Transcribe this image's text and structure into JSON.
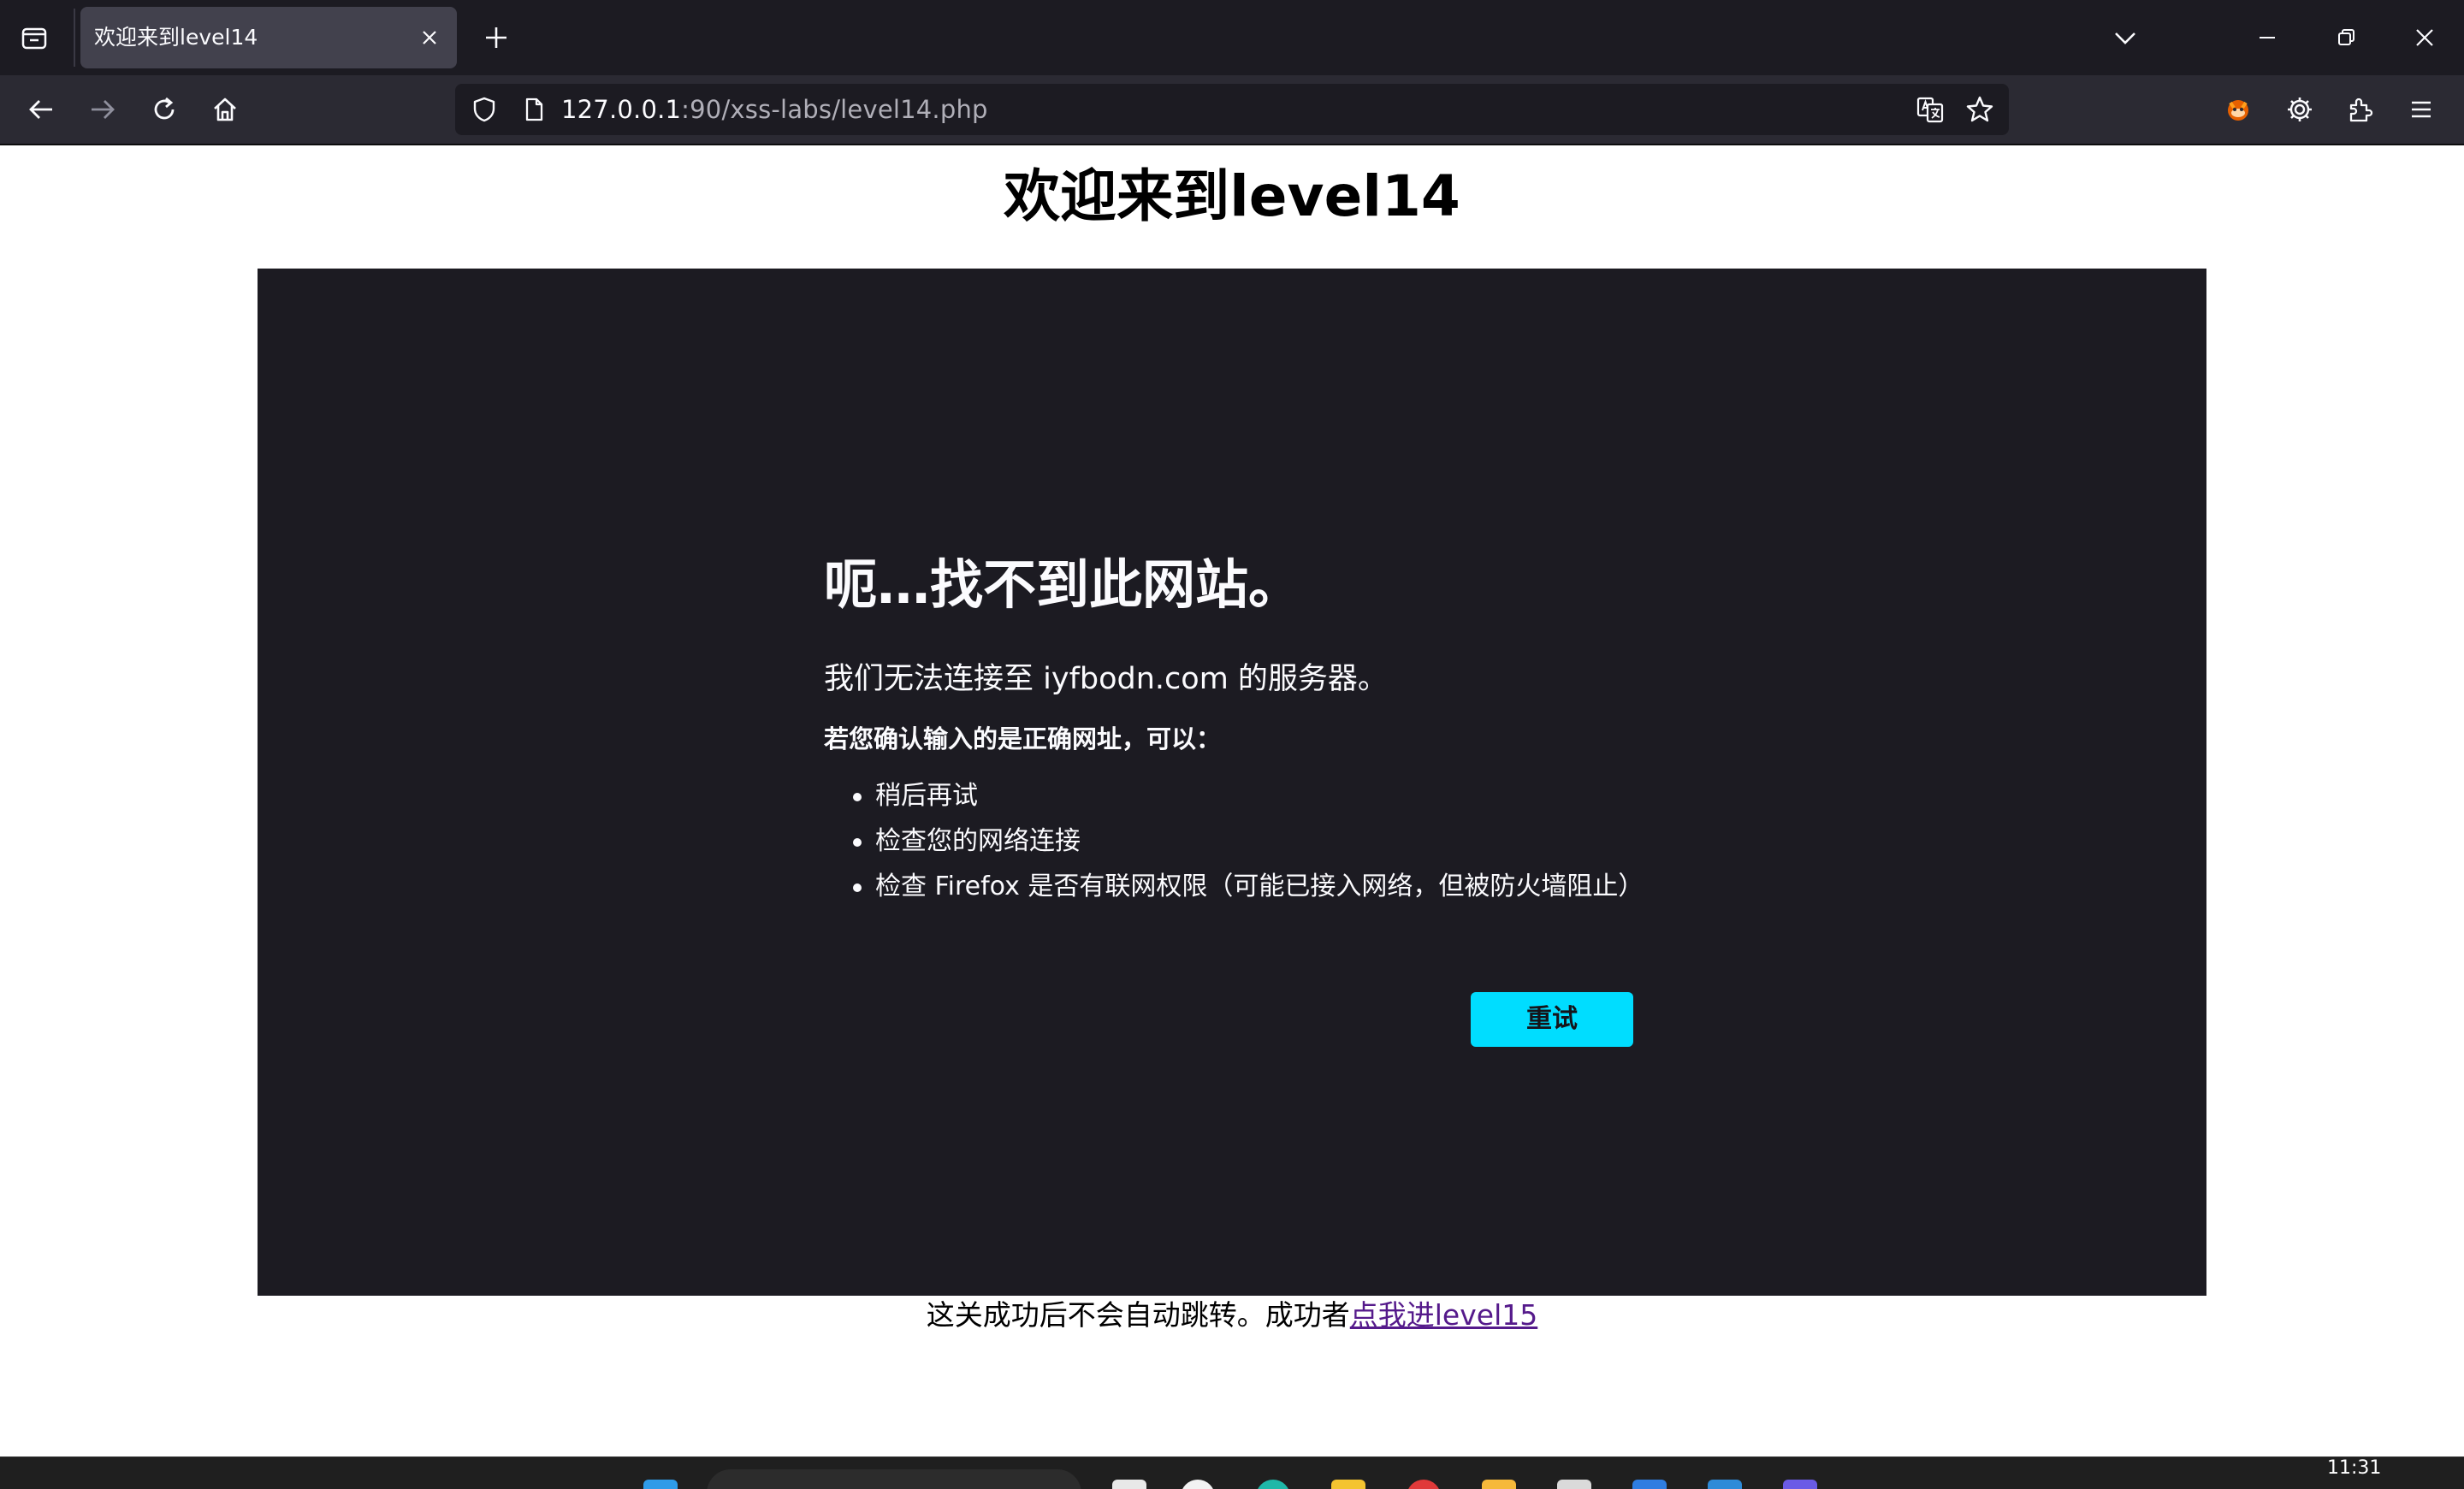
{
  "browser": {
    "tab_title": "欢迎来到level14",
    "url_host": "127.0.0.1",
    "url_path": ":90/xss-labs/level14.php"
  },
  "page": {
    "heading": "欢迎来到level14",
    "footer_text": "这关成功后不会自动跳转。成功者",
    "footer_link": "点我进level15"
  },
  "error": {
    "title": "呃…找不到此网站。",
    "description": "我们无法连接至 iyfbodn.com 的服务器。",
    "hint": "若您确认输入的是正确网址，可以：",
    "suggestions": [
      "稍后再试",
      "检查您的网络连接",
      "检查 Firefox 是否有联网权限（可能已接入网络，但被防火墙阻止）"
    ],
    "retry_label": "重试"
  },
  "taskbar": {
    "clock": "11:31"
  },
  "colors": {
    "chrome_dark": "#1c1b22",
    "toolbar": "#2b2a33",
    "accent": "#00ddff",
    "visited_link": "#551a8b"
  },
  "icons": {
    "tab_bar": [
      "tab-list-icon",
      "close-icon",
      "plus-icon",
      "chevron-down-icon",
      "minimize-icon",
      "restore-icon",
      "window-close-icon"
    ],
    "toolbar": [
      "back-arrow-icon",
      "forward-arrow-icon",
      "reload-icon",
      "home-icon",
      "shield-icon",
      "page-icon",
      "translate-icon",
      "star-icon",
      "extension-fox-icon",
      "gear-icon",
      "puzzle-icon",
      "menu-icon"
    ]
  }
}
